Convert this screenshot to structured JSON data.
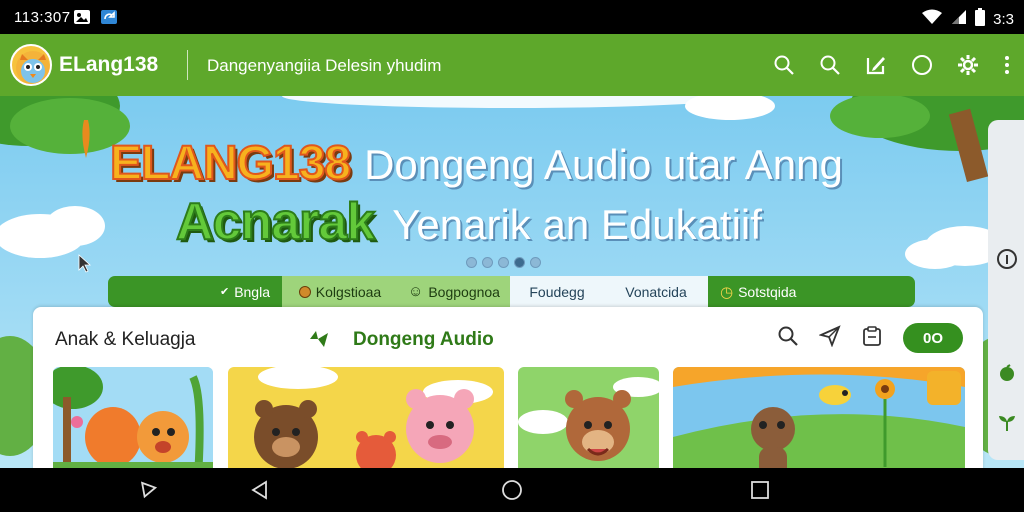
{
  "status_bar": {
    "time": "113:307",
    "clock": "3:3",
    "icons": [
      "photo-notification-icon",
      "app-notification-icon",
      "wifi-icon",
      "signal-icon",
      "battery-icon"
    ]
  },
  "app_bar": {
    "title": "ELang138",
    "subtitle": "Dangenyangiia  Delesin yhudim",
    "actions": [
      "search-icon",
      "search-icon",
      "edit-icon",
      "circle-icon",
      "settings-icon",
      "more-vert-icon"
    ]
  },
  "hero": {
    "brand_word": "ELANG138",
    "line1_rest": "Dongeng Audio utar Anng",
    "accent_word": "Acnarak",
    "line2_rest": "Yenarik an Edukatiif",
    "dots": 5,
    "active_dot": 3
  },
  "tabs": [
    {
      "label": "Bngla",
      "icon": "check-icon",
      "style": "green"
    },
    {
      "label": "Kolgstioaa",
      "icon": "circle-icon",
      "style": "light"
    },
    {
      "label": "Bogpognoa",
      "icon": "smile-icon",
      "style": "light"
    },
    {
      "label": "Foudegg",
      "icon": "",
      "style": "white"
    },
    {
      "label": "Vonatcida",
      "icon": "",
      "style": "white"
    },
    {
      "label": "Sotstqida",
      "icon": "clock-icon",
      "style": "green"
    }
  ],
  "section": {
    "title": "Anak & Keluagja",
    "subtitle": "Dongeng Audio",
    "pill_label": "0O",
    "actions": [
      "search-icon",
      "send-icon",
      "clipboard-icon"
    ]
  },
  "colors": {
    "app_bar": "#5ea82b",
    "tabs_bg": "#3b9526",
    "sky": "#8fd3f3",
    "accent_green": "#2f7a18"
  }
}
